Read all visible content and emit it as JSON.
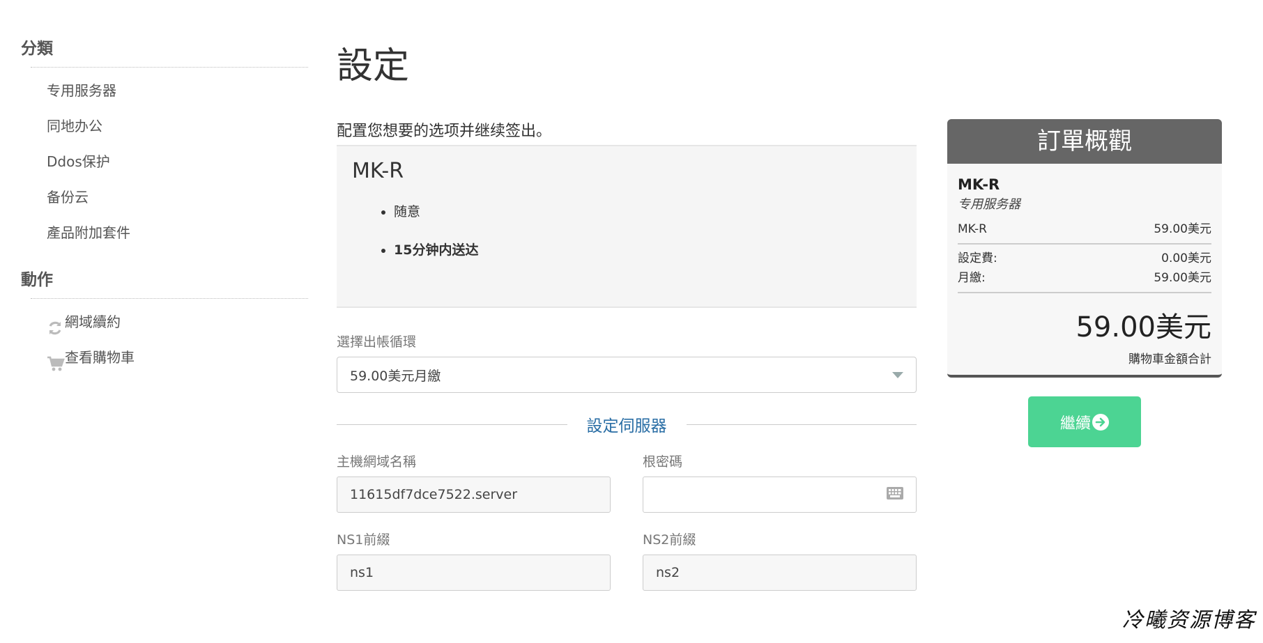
{
  "sidebar": {
    "categories_heading": "分類",
    "categories": [
      {
        "label": "专用服务器"
      },
      {
        "label": "同地办公"
      },
      {
        "label": "Ddos保护"
      },
      {
        "label": "备份云"
      },
      {
        "label": "產品附加套件"
      }
    ],
    "actions_heading": "動作",
    "actions": [
      {
        "label": "網域續約",
        "icon": "refresh-icon"
      },
      {
        "label": "查看購物車",
        "icon": "cart-icon"
      }
    ]
  },
  "page": {
    "title": "設定",
    "intro": "配置您想要的选项并继续签出。"
  },
  "product": {
    "name": "MK-R",
    "features": [
      "随意",
      "15分钟内送达"
    ]
  },
  "billing": {
    "label": "選擇出帳循環",
    "selected": "59.00美元月繳"
  },
  "server": {
    "section_title": "設定伺服器",
    "hostname_label": "主機網域名稱",
    "hostname_value": "11615df7dce7522.server",
    "rootpw_label": "根密碼",
    "rootpw_value": "",
    "ns1_label": "NS1前綴",
    "ns1_value": "ns1",
    "ns2_label": "NS2前綴",
    "ns2_value": "ns2"
  },
  "summary": {
    "title": "訂單概觀",
    "product_name": "MK-R",
    "product_group": "专用服务器",
    "line_item_label": "MK-R",
    "line_item_price": "59.00美元",
    "setup_label": "設定費:",
    "setup_value": "0.00美元",
    "monthly_label": "月繳:",
    "monthly_value": "59.00美元",
    "total": "59.00美元",
    "total_label": "購物車金額合計"
  },
  "continue_label": "繼續",
  "watermark": "冷曦资源博客",
  "colors": {
    "accent_green": "#4cd493",
    "summary_header": "#666666",
    "link_blue": "#2a6ea5"
  }
}
